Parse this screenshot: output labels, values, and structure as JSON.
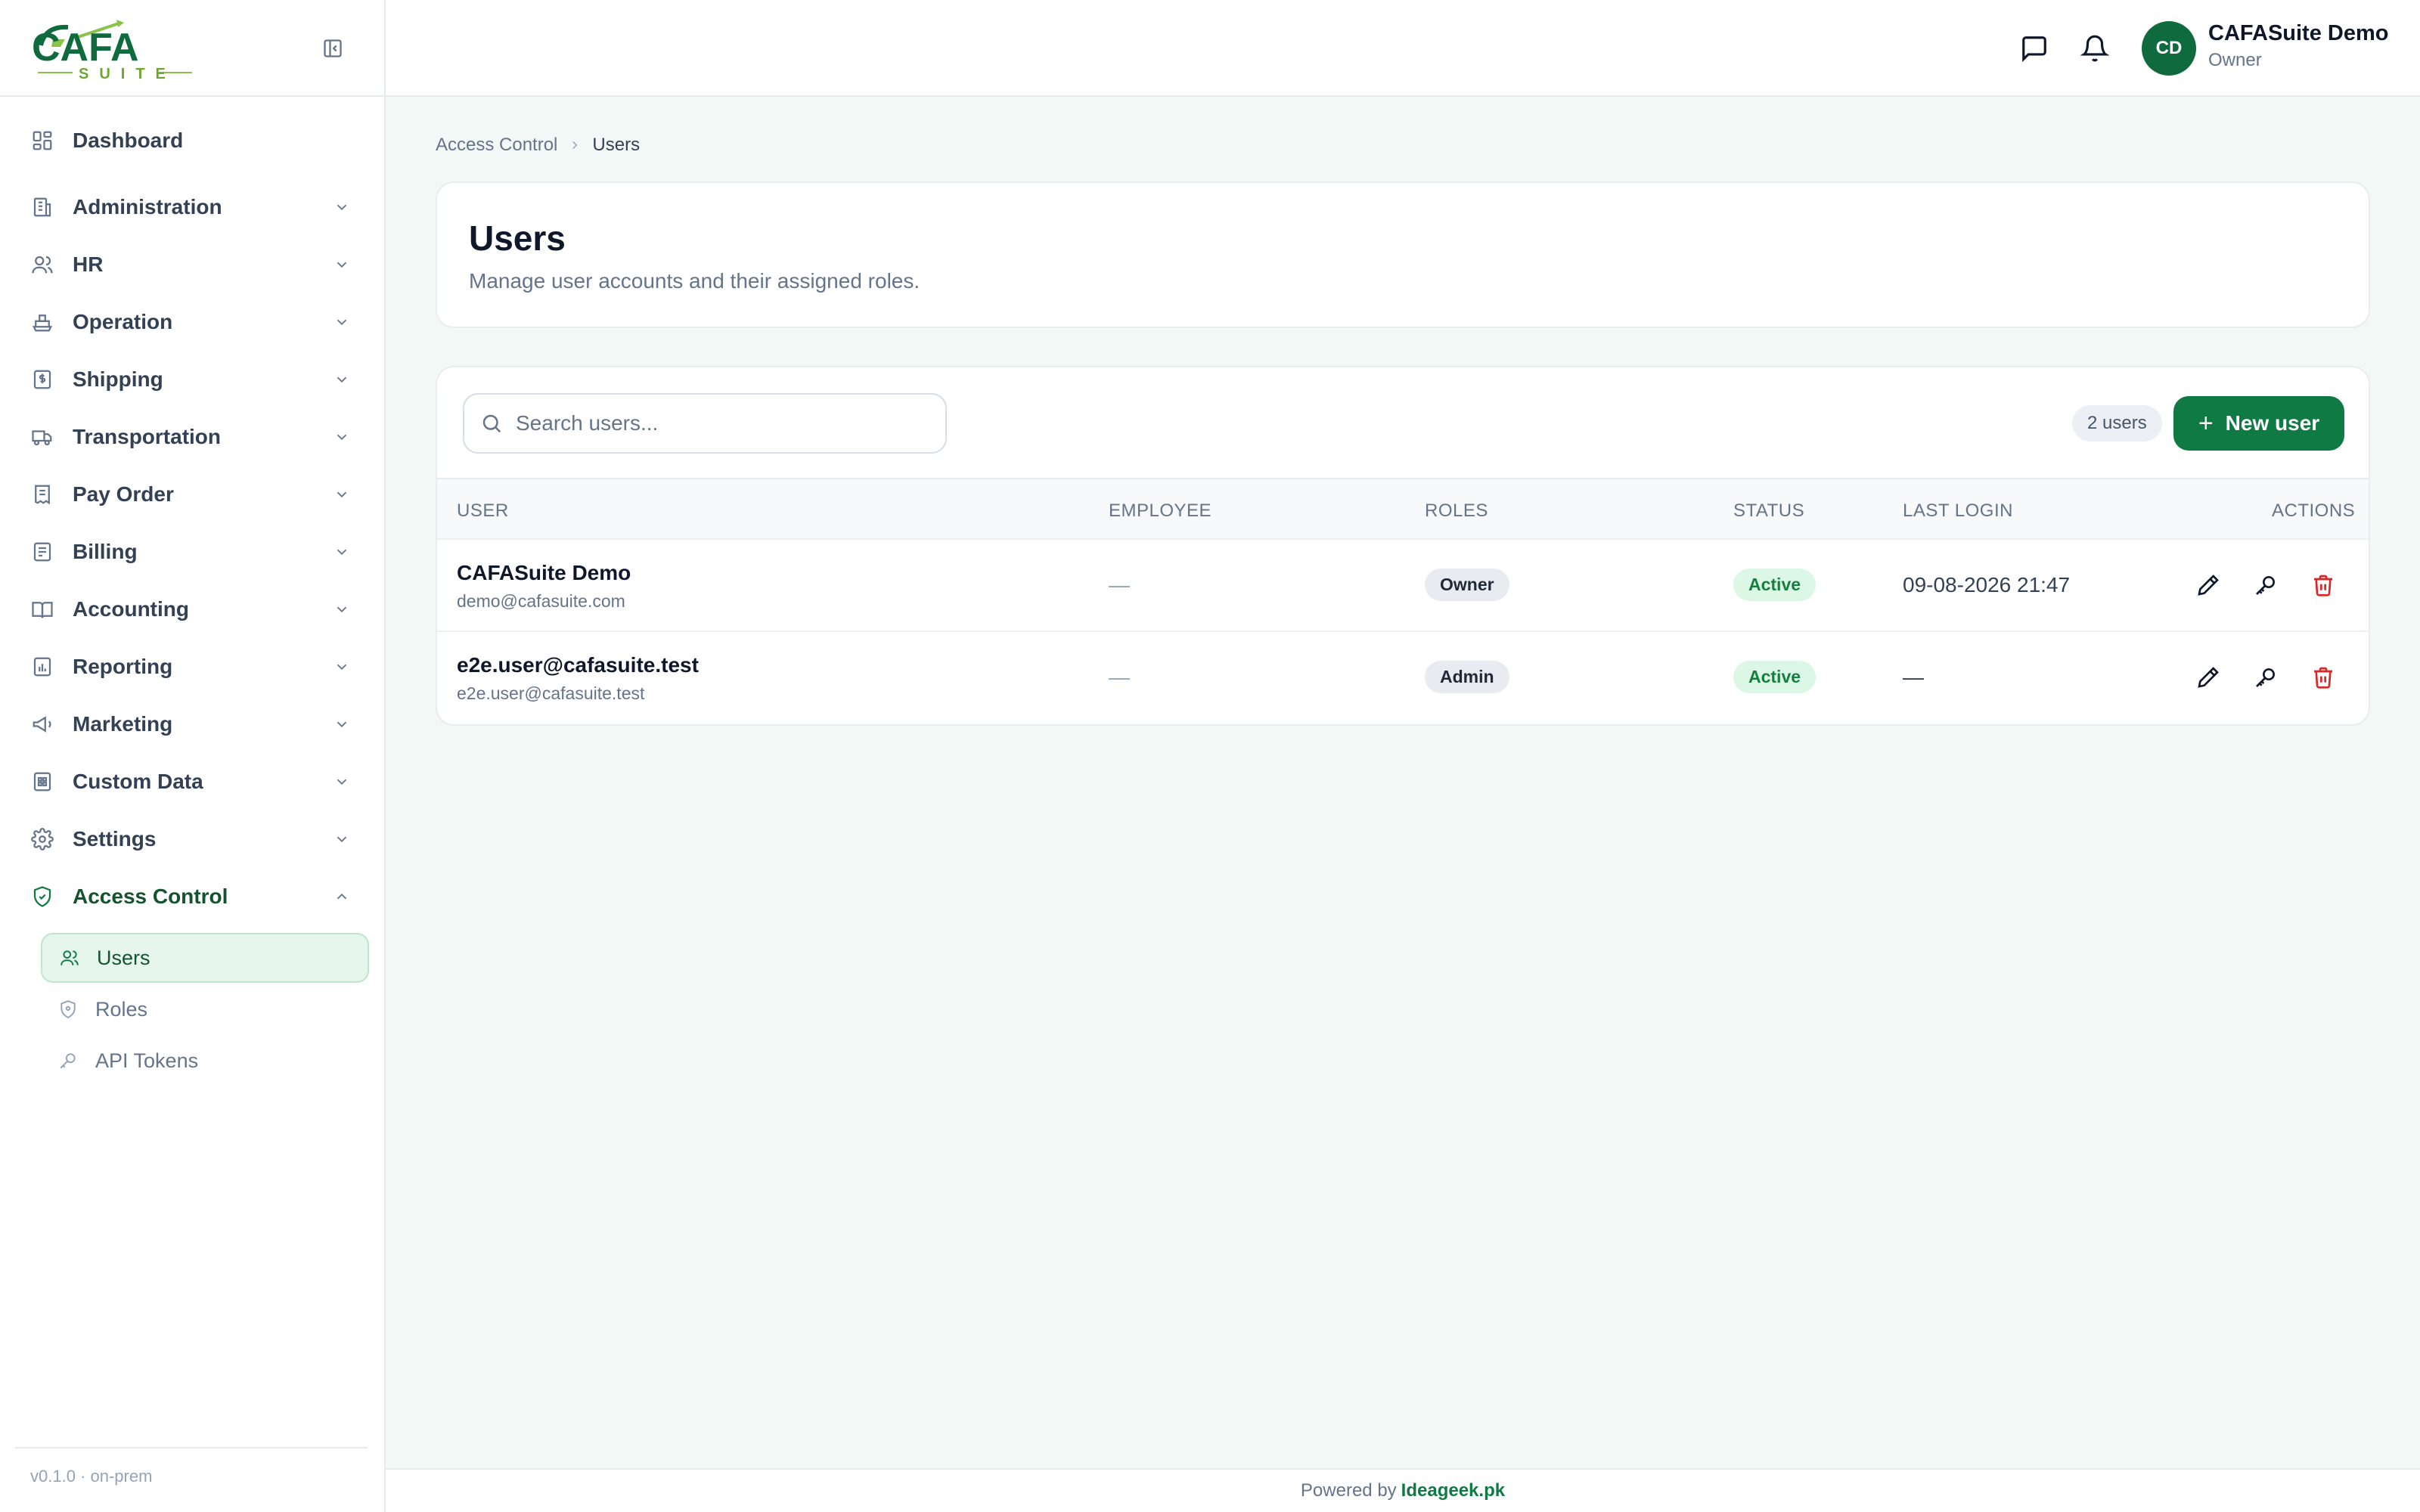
{
  "brand": {
    "logo_text": "CAFA",
    "logo_subtext": "SUITE",
    "version": "v0.1.0 · on-prem"
  },
  "sidebar": {
    "items": [
      {
        "label": "Dashboard",
        "icon": "dashboard-icon"
      },
      {
        "label": "Administration",
        "icon": "building-icon"
      },
      {
        "label": "HR",
        "icon": "users-icon"
      },
      {
        "label": "Operation",
        "icon": "ship-icon"
      },
      {
        "label": "Shipping",
        "icon": "dollar-file-icon"
      },
      {
        "label": "Transportation",
        "icon": "truck-icon"
      },
      {
        "label": "Pay Order",
        "icon": "receipt-icon"
      },
      {
        "label": "Billing",
        "icon": "billing-icon"
      },
      {
        "label": "Accounting",
        "icon": "book-icon"
      },
      {
        "label": "Reporting",
        "icon": "report-icon"
      },
      {
        "label": "Marketing",
        "icon": "megaphone-icon"
      },
      {
        "label": "Custom Data",
        "icon": "database-file-icon"
      },
      {
        "label": "Settings",
        "icon": "gear-icon"
      },
      {
        "label": "Access Control",
        "icon": "shield-check-icon"
      }
    ],
    "subitems": [
      {
        "label": "Users",
        "icon": "users-icon"
      },
      {
        "label": "Roles",
        "icon": "shield-icon"
      },
      {
        "label": "API Tokens",
        "icon": "key-icon"
      }
    ]
  },
  "topbar": {
    "user_initials": "CD",
    "user_name": "CAFASuite Demo",
    "user_role": "Owner"
  },
  "breadcrumb": {
    "parent": "Access Control",
    "current": "Users"
  },
  "page": {
    "title": "Users",
    "subtitle": "Manage user accounts and their assigned roles."
  },
  "toolbar": {
    "search_placeholder": "Search users...",
    "count_label": "2 users",
    "new_button_label": "New user"
  },
  "table": {
    "columns": [
      "USER",
      "EMPLOYEE",
      "ROLES",
      "STATUS",
      "LAST LOGIN",
      "ACTIONS"
    ],
    "rows": [
      {
        "name": "CAFASuite Demo",
        "email": "demo@cafasuite.com",
        "employee": "—",
        "role": "Owner",
        "status": "Active",
        "last_login": "09-08-2026 21:47"
      },
      {
        "name": "e2e.user@cafasuite.test",
        "email": "e2e.user@cafasuite.test",
        "employee": "—",
        "role": "Admin",
        "status": "Active",
        "last_login": "—"
      }
    ]
  },
  "footer": {
    "prefix": "Powered by",
    "link": "Ideageek.pk"
  },
  "colors": {
    "brand_green": "#0f7a43",
    "avatar_green": "#0f6b3d",
    "active_bg": "#dcf7e6",
    "active_text": "#15803d",
    "delete_red": "#dc2626"
  }
}
